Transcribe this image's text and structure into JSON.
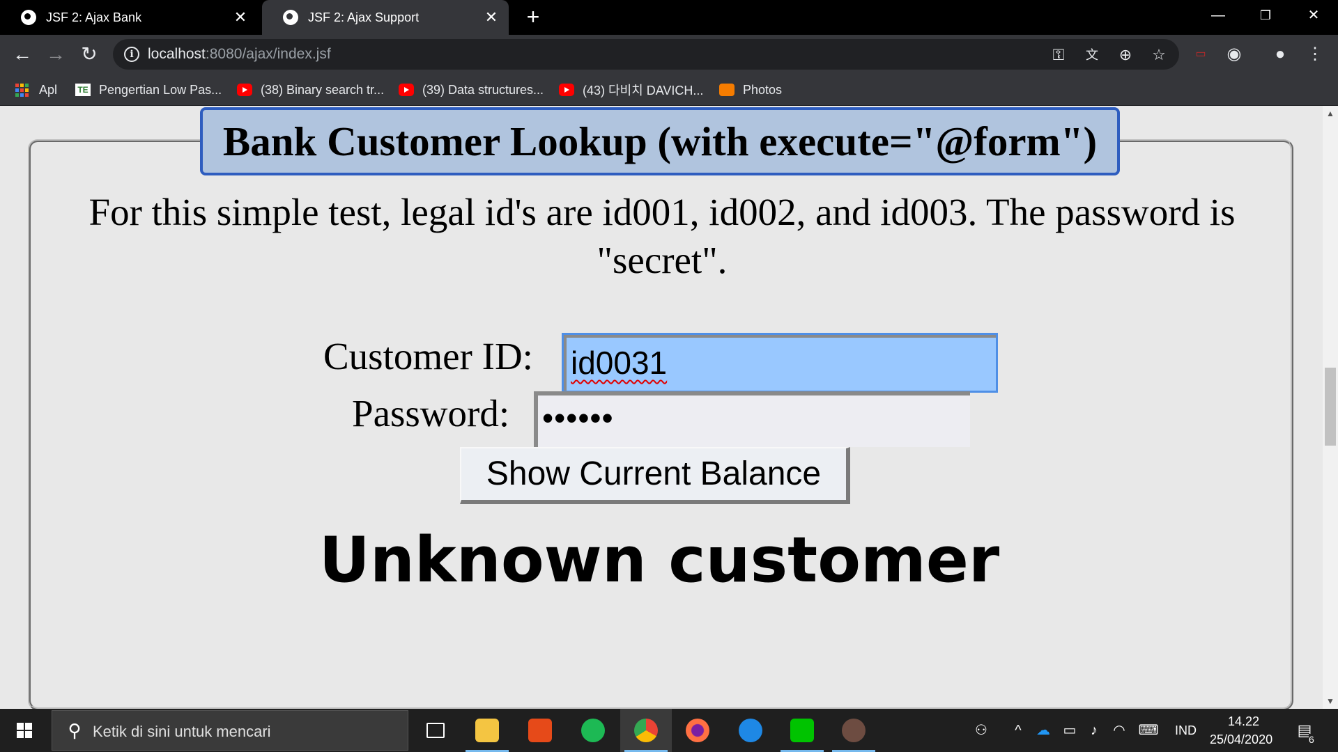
{
  "browser": {
    "tabs": [
      {
        "title": "JSF 2: Ajax Bank",
        "active": false
      },
      {
        "title": "JSF 2: Ajax Support",
        "active": true
      }
    ],
    "new_tab": "+",
    "url_host": "localhost",
    "url_rest": ":8080/ajax/index.jsf",
    "bookmarks": [
      {
        "label": "Apl",
        "icon": "apps-grid-icon"
      },
      {
        "label": "Pengertian Low Pas...",
        "icon": "te-favicon"
      },
      {
        "label": "(38) Binary search tr...",
        "icon": "youtube-icon"
      },
      {
        "label": "(39) Data structures...",
        "icon": "youtube-icon"
      },
      {
        "label": "(43) 다비치 DAVICH...",
        "icon": "youtube-icon"
      },
      {
        "label": "Photos",
        "icon": "photos-icon"
      }
    ]
  },
  "page": {
    "legend": "Bank Customer Lookup (with execute=\"@form\")",
    "intro": "For this simple test, legal id's are id001, id002, and id003. The password is \"secret\".",
    "customer_id_label": "Customer ID:",
    "customer_id_value": "id0031",
    "password_label": "Password:",
    "password_mask": "••••••",
    "submit_label": "Show Current Balance",
    "result": "Unknown customer"
  },
  "taskbar": {
    "search_placeholder": "Ketik di sini untuk mencari",
    "language": "IND",
    "time": "14.22",
    "date": "25/04/2020",
    "notification_count": "6"
  },
  "colors": {
    "legend_bg": "#b0c4de",
    "legend_border": "#2e5dbf",
    "id_input_bg": "#99c8ff",
    "page_bg": "#e8e8e8"
  }
}
